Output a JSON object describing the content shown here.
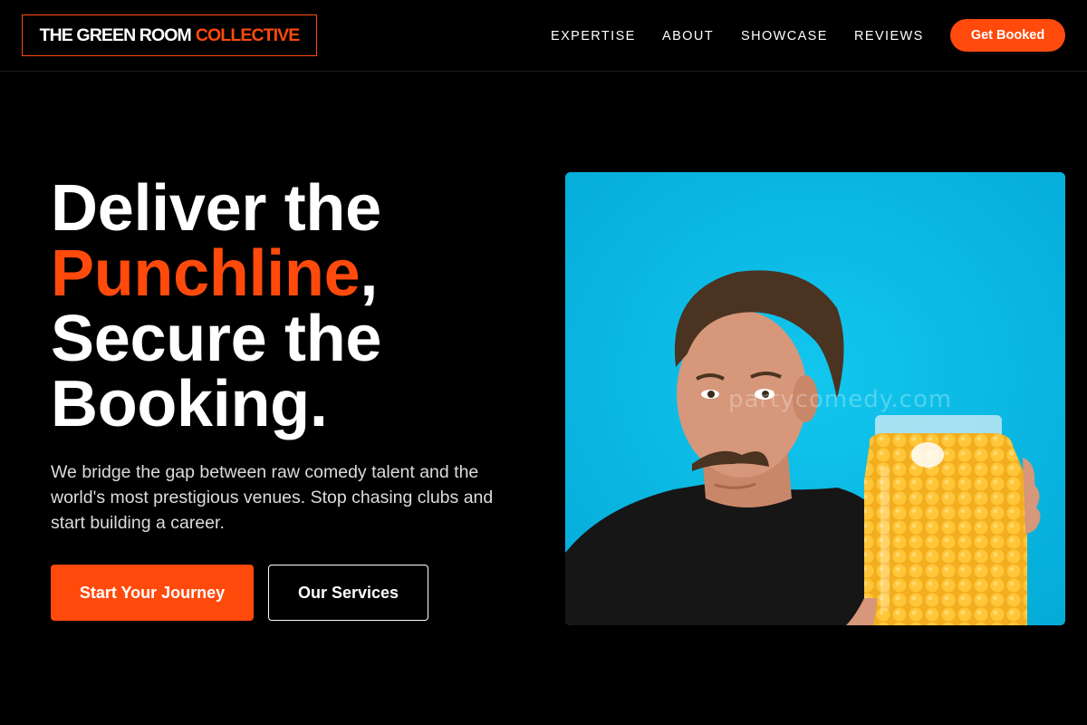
{
  "header": {
    "logo_main": "THE GREEN ROOM",
    "logo_accent": "COLLECTIVE",
    "nav": [
      "EXPERTISE",
      "ABOUT",
      "SHOWCASE",
      "REVIEWS"
    ],
    "cta_label": "Get Booked"
  },
  "hero": {
    "line1": "Deliver the",
    "highlight": "Punchline",
    "comma": ",",
    "line3": "Secure the",
    "line4": "Booking.",
    "description": "We bridge the gap between raw comedy talent and the world's most prestigious venues. Stop chasing clubs and start building a career.",
    "primary_button": "Start Your Journey",
    "secondary_button": "Our Services",
    "watermark": "partycomedy.com"
  },
  "colors": {
    "accent": "#ff4a0c",
    "background": "#000000",
    "image_background": "#07bde6"
  }
}
